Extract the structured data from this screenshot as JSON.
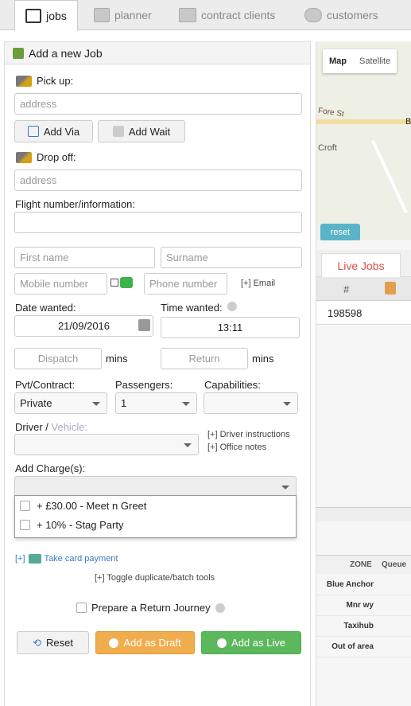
{
  "nav": {
    "jobs": "jobs",
    "planner": "planner",
    "contract_clients": "contract clients",
    "customers": "customers"
  },
  "form": {
    "title": "Add a new Job",
    "pickup_label": "Pick up:",
    "pickup_placeholder": "address",
    "add_via": "Add Via",
    "add_wait": "Add Wait",
    "dropoff_label": "Drop off:",
    "dropoff_placeholder": "address",
    "flight_label": "Flight number/information:",
    "first_name": "First name",
    "surname": "Surname",
    "mobile": "Mobile number",
    "phone": "Phone number",
    "email_link": "[+] Email",
    "date_label": "Date wanted:",
    "date_value": "21/09/2016",
    "time_label": "Time wanted:",
    "time_value": "13:11",
    "dispatch": "Dispatch",
    "mins1": "mins",
    "return": "Return",
    "mins2": "mins",
    "pvt_label": "Pvt/Contract:",
    "pvt_value": "Private",
    "passengers_label": "Passengers:",
    "passengers_value": "1",
    "capabilities_label": "Capabilities:",
    "driver_label": "Driver /",
    "vehicle_label": "Vehicle:",
    "driver_instructions": "[+] Driver instructions",
    "office_notes": "[+] Office notes",
    "charges_label": "Add Charge(s):",
    "charge_options": [
      "+ £30.00 - Meet n Greet",
      "+ 10% - Stag Party"
    ],
    "take_card": "Take card payment",
    "toggle_dup": "[+] Toggle duplicate/batch tools",
    "return_journey": "Prepare a Return Journey",
    "reset": "Reset",
    "add_draft": "Add as Draft",
    "add_live": "Add as Live"
  },
  "map": {
    "map_btn": "Map",
    "satellite_btn": "Satellite",
    "road1": "Fore St",
    "road2": "Croft",
    "reset": "reset",
    "letter": "B"
  },
  "live": {
    "tab": "Live Jobs",
    "col_hash": "#",
    "row_id": "198598"
  },
  "zones": {
    "header_zone": "ZONE",
    "header_queue": "Queue",
    "rows": [
      "Blue Anchor",
      "Mnr wy",
      "Taxihub",
      "Out of area"
    ]
  }
}
